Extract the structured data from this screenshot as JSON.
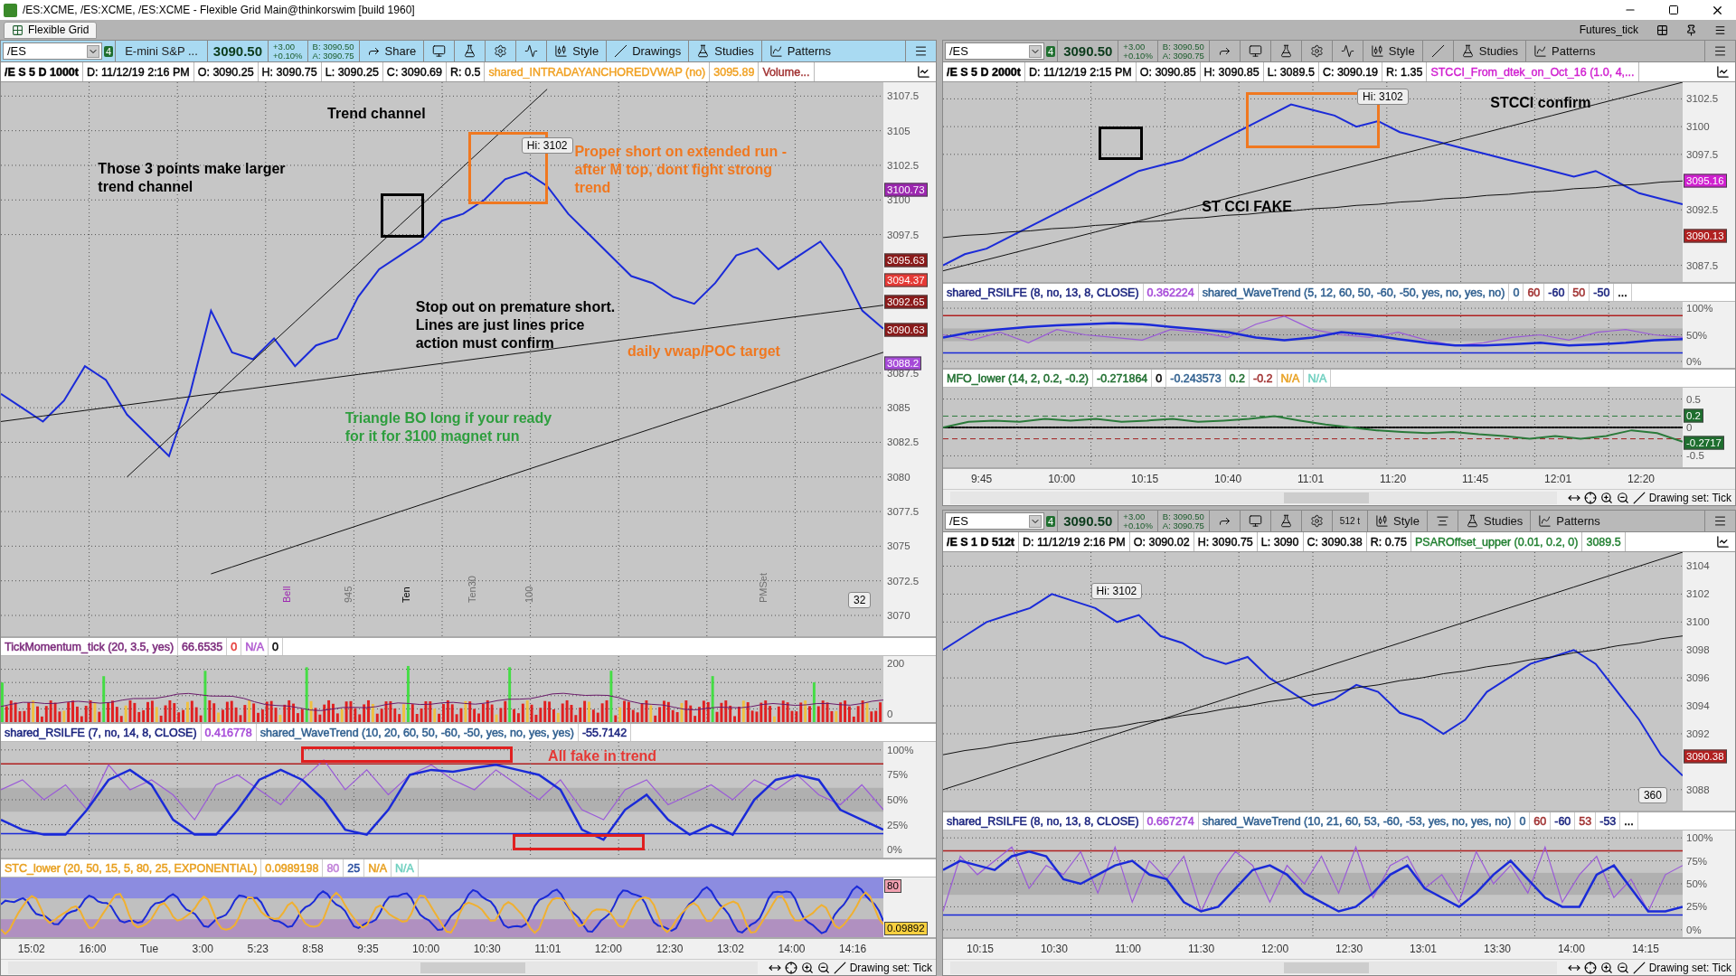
{
  "window": {
    "title": "/ES:XCME, /ES:XCME, /ES:XCME - Flexible Grid Main@thinkorswim [build 1960]"
  },
  "tab": {
    "label": "Flexible Grid",
    "selected": true
  },
  "grid_name": "Futures_tick",
  "charts": [
    {
      "focused": true,
      "toolbar": {
        "symbol": "/ES",
        "badge": "4",
        "name": "E-mini S&P ...",
        "price": "3090.50",
        "change": "+3.00",
        "change_pct": "+0.10%",
        "bid": "B: 3090.50",
        "ask": "A: 3090.75",
        "buttons": [
          {
            "kind": "share",
            "label": "Share"
          },
          {
            "kind": "monitor"
          },
          {
            "kind": "flask"
          },
          {
            "kind": "gear"
          },
          {
            "kind": "wave"
          },
          {
            "kind": "style",
            "label": "Style"
          },
          {
            "kind": "line",
            "label": "Drawings"
          },
          {
            "kind": "flask",
            "label": "Studies"
          },
          {
            "kind": "patterns",
            "label": "Patterns"
          },
          {
            "kind": "menu"
          }
        ]
      },
      "info": [
        {
          "text": "/E S 5 D 1000t",
          "color": "#000000"
        },
        {
          "text": "D: 11/12/19 2:16 PM",
          "color": "#000000"
        },
        {
          "text": "O: 3090.25",
          "color": "#000000"
        },
        {
          "text": "H: 3090.75",
          "color": "#000000"
        },
        {
          "text": "L: 3090.25",
          "color": "#000000"
        },
        {
          "text": "C: 3090.69",
          "color": "#000000"
        },
        {
          "text": "R: 0.5",
          "color": "#000000"
        },
        {
          "text": "shared_INTRADAYANCHOREDVWAP (no)",
          "color": "#f0a020"
        },
        {
          "text": "3095.89",
          "color": "#f0a020"
        },
        {
          "text": "Volume...",
          "color": "#a03030"
        }
      ],
      "panes": [
        {
          "kind": "price",
          "chart_data": {
            "type": "line",
            "ylim": [
              3068.5,
              3108.5
            ],
            "yticks": [
              3107.5,
              3105,
              3102.5,
              3100,
              3097.5,
              3087.5,
              3085,
              3082.5,
              3080,
              3077.5,
              3075,
              3072.5,
              3070
            ],
            "grid": true,
            "series": [
              {
                "color": "#1a2ad8",
                "values": [
                  3086,
                  3085,
                  3084,
                  3085.5,
                  3088,
                  3087,
                  3084.5,
                  3083,
                  3081.5,
                  3086,
                  3092,
                  3089,
                  3088.5,
                  3090,
                  3088,
                  3089.5,
                  3090,
                  3093,
                  3095,
                  3096,
                  3097,
                  3098.5,
                  3099,
                  3100,
                  3101.5,
                  3102,
                  3101,
                  3099,
                  3097.5,
                  3096,
                  3094.5,
                  3094,
                  3093,
                  3092.5,
                  3094,
                  3096,
                  3096.5,
                  3095,
                  3096,
                  3097,
                  3095,
                  3092,
                  3090.7
                ]
              },
              {
                "color": "#111111",
                "values": [
                  null,
                  null,
                  null,
                  null,
                  null,
                  null,
                  3080,
                  3081.4,
                  3082.8,
                  3084.2,
                  3085.6,
                  3087,
                  3088.4,
                  3089.8,
                  3091.2,
                  3092.6,
                  3094,
                  3095.4,
                  3096.8,
                  3098.2,
                  3099.6,
                  3101,
                  3102.4,
                  3103.8,
                  3105.2,
                  3106.6,
                  3108,
                  null,
                  null,
                  null,
                  null,
                  null,
                  null,
                  null,
                  null,
                  null,
                  null,
                  null,
                  null,
                  null,
                  null,
                  null,
                  null
                ]
              },
              {
                "color": "#111111",
                "values": [
                  3084,
                  3084.2,
                  3084.4,
                  3084.6,
                  3084.8,
                  3085,
                  3085.2,
                  3085.4,
                  3085.6,
                  3085.8,
                  3086,
                  3086.2,
                  3086.4,
                  3086.6,
                  3086.8,
                  3087,
                  3087.2,
                  3087.4,
                  3087.6,
                  3087.8,
                  3088,
                  3088.2,
                  3088.4,
                  3088.6,
                  3088.8,
                  3089,
                  3089.2,
                  3089.4,
                  3089.6,
                  3089.8,
                  3090,
                  3090.2,
                  3090.4,
                  3090.6,
                  3090.8,
                  3091,
                  3091.2,
                  3091.4,
                  3091.6,
                  3091.8,
                  3092,
                  3092.2,
                  3092.4
                ]
              },
              {
                "color": "#111111",
                "values": [
                  null,
                  null,
                  null,
                  null,
                  null,
                  null,
                  null,
                  null,
                  null,
                  null,
                  3073,
                  3073.5,
                  3074,
                  3074.5,
                  3075,
                  3075.5,
                  3076,
                  3076.5,
                  3077,
                  3077.5,
                  3078,
                  3078.5,
                  3079,
                  3079.5,
                  3080,
                  3080.5,
                  3081,
                  3081.5,
                  3082,
                  3082.5,
                  3083,
                  3083.5,
                  3084,
                  3084.5,
                  3085,
                  3085.5,
                  3086,
                  3086.5,
                  3087,
                  3087.5,
                  3088,
                  3088.5,
                  3089
                ]
              }
            ]
          },
          "axis": [
            {
              "kind": "tag",
              "text": "3100.73",
              "color": "#9c27b0"
            },
            {
              "kind": "tag",
              "text": "3095.63",
              "color": "#8b1a1a"
            },
            {
              "kind": "tag",
              "text": "3094.37",
              "color": "#e53935"
            },
            {
              "kind": "tag",
              "text": "3092.65",
              "color": "#8b1a1a"
            },
            {
              "kind": "tag",
              "text": "3090.63",
              "color": "#8b1a1a"
            },
            {
              "kind": "tag",
              "text": "3088.2",
              "color": "#a64ad8"
            }
          ],
          "annotations": [
            {
              "kind": "note",
              "text": "Trend channel",
              "color": "#000000"
            },
            {
              "kind": "note",
              "text": "Those 3 points make larger trend channel",
              "color": "#000000"
            },
            {
              "kind": "note",
              "text": "Proper short on extended run - after M top, dont fight strong trend",
              "color": "#f07820"
            },
            {
              "kind": "note",
              "text": "Stop out on premature short. Lines are just lines price action must confirm",
              "color": "#000000"
            },
            {
              "kind": "note",
              "text": "daily vwap/POC target",
              "color": "#f07820"
            },
            {
              "kind": "note",
              "text": "Triangle BO long if your ready for it for 3100 magnet run",
              "color": "#2e9e3e"
            },
            {
              "kind": "label",
              "text": "Hi: 3102",
              "color": "#000000"
            },
            {
              "kind": "label",
              "text": "32",
              "color": "#000000"
            },
            {
              "kind": "vertical",
              "text": "Bell",
              "color": "#9c27b0"
            },
            {
              "kind": "vertical",
              "text": "945",
              "color": "#707070"
            },
            {
              "kind": "vertical",
              "text": "Ten",
              "color": "#000000"
            },
            {
              "kind": "vertical",
              "text": "Ten30",
              "color": "#707070"
            },
            {
              "kind": "vertical",
              "text": "100",
              "color": "#707070"
            },
            {
              "kind": "vertical",
              "text": "PMSet",
              "color": "#707070"
            }
          ]
        },
        {
          "kind": "histogram",
          "studies": [
            {
              "text": "TickMomentum_tick (20, 3.5, yes)",
              "color": "#7b2a7b"
            },
            {
              "text": "66.6535",
              "color": "#7b2a7b"
            },
            {
              "text": "0",
              "color": "#e53935"
            },
            {
              "text": "N/A",
              "color": "#b05ad0"
            },
            {
              "text": "0",
              "color": "#000000"
            }
          ],
          "axis": [
            {
              "kind": "tick",
              "text": "200"
            },
            {
              "kind": "tick",
              "text": "0"
            }
          ]
        },
        {
          "kind": "oscillator",
          "studies": [
            {
              "text": "shared_RSILFE (7, no, 14, 8, CLOSE)",
              "color": "#1a237e"
            },
            {
              "text": "0.416778",
              "color": "#a64ad8"
            },
            {
              "text": "shared_WaveTrend (10, 20, 60, 50, -60, -50, yes, no, yes, yes)",
              "color": "#2f5f8f"
            },
            {
              "text": "-55.7142",
              "color": "#1a237e"
            }
          ],
          "chart_data": {
            "type": "line",
            "ylim": [
              -8,
              108
            ],
            "yticks": [
              {
                "value": 100,
                "label": "100%"
              },
              {
                "value": 75,
                "label": "75%"
              },
              {
                "value": 50,
                "label": "50%"
              },
              {
                "value": 25,
                "label": "25%"
              },
              {
                "value": 0,
                "label": "0%"
              }
            ],
            "grid": true,
            "series": [
              {
                "color": "#9a5ad8",
                "values": [
                  60,
                  70,
                  50,
                  65,
                  40,
                  85,
                  60,
                  70,
                  55,
                  30,
                  65,
                  75,
                  60,
                  45,
                  70,
                  90,
                  60,
                  80,
                  55,
                  75,
                  85,
                  70,
                  60,
                  80,
                  65,
                  50,
                  70,
                  40,
                  30,
                  60,
                  70,
                  45,
                  55,
                  65,
                  50,
                  70,
                  60,
                  75,
                  55,
                  45,
                  65,
                  40
                ]
              },
              {
                "color": "#1a2ad8",
                "values": [
                  30,
                  20,
                  15,
                  15,
                  40,
                  70,
                  80,
                  65,
                  30,
                  15,
                  15,
                  40,
                  70,
                  80,
                  70,
                  50,
                  20,
                  15,
                  40,
                  75,
                  80,
                  78,
                  82,
                  85,
                  80,
                  75,
                  60,
                  20,
                  10,
                  40,
                  55,
                  30,
                  15,
                  25,
                  15,
                  50,
                  70,
                  75,
                  70,
                  40,
                  30,
                  20
                ]
              }
            ]
          },
          "annotations": [
            {
              "kind": "note",
              "text": "All fake in trend",
              "color": "#e53935"
            }
          ]
        },
        {
          "kind": "stc",
          "studies": [
            {
              "text": "STC_lower (20, 50, 15, 5, 80, 25, EXPONENTIAL)",
              "color": "#e8a020"
            },
            {
              "text": "0.0989198",
              "color": "#e8a020"
            },
            {
              "text": "80",
              "color": "#c080d8"
            },
            {
              "text": "25",
              "color": "#2a4ea0"
            },
            {
              "text": "N/A",
              "color": "#e8a020"
            },
            {
              "text": "N/A",
              "color": "#70d0c0"
            }
          ],
          "axis": [
            {
              "kind": "tag",
              "text": "80",
              "color": "#f0a0b0"
            },
            {
              "kind": "tag",
              "text": "0.09892",
              "color": "#f8d040"
            }
          ]
        }
      ],
      "x_axis": [
        "15:02",
        "16:00",
        "Tue",
        "3:00",
        "5:23",
        "8:58",
        "9:35",
        "10:00",
        "10:30",
        "11:01",
        "12:00",
        "12:30",
        "13:02",
        "14:00",
        "14:16"
      ],
      "drawing_set": "Drawing set: Tick"
    },
    {
      "focused": false,
      "toolbar": {
        "symbol": "/ES",
        "badge": "4",
        "price": "3090.50",
        "change": "+3.00",
        "change_pct": "+0.10%",
        "bid": "B: 3090.50",
        "ask": "A: 3090.75",
        "buttons": [
          {
            "kind": "share"
          },
          {
            "kind": "monitor"
          },
          {
            "kind": "flask"
          },
          {
            "kind": "gear"
          },
          {
            "kind": "wave"
          },
          {
            "kind": "style",
            "label": "Style"
          },
          {
            "kind": "line"
          },
          {
            "kind": "flask",
            "label": "Studies"
          },
          {
            "kind": "patterns",
            "label": "Patterns"
          },
          {
            "kind": "menu"
          }
        ]
      },
      "info": [
        {
          "text": "/E S 5 D 2000t",
          "color": "#000000"
        },
        {
          "text": "D: 11/12/19 2:15 PM",
          "color": "#000000"
        },
        {
          "text": "O: 3090.85",
          "color": "#000000"
        },
        {
          "text": "H: 3090.85",
          "color": "#000000"
        },
        {
          "text": "L: 3089.5",
          "color": "#000000"
        },
        {
          "text": "C: 3090.19",
          "color": "#000000"
        },
        {
          "text": "R: 1.35",
          "color": "#000000"
        },
        {
          "text": "STCCI_From_dtek_on_Oct_16 (1.0, 4,...",
          "color": "#d020d0"
        }
      ],
      "panes": [
        {
          "kind": "price",
          "chart_data": {
            "type": "line",
            "ylim": [
              3086,
              3104
            ],
            "yticks": [
              3102.5,
              3100,
              3097.5,
              3092.5,
              3087.5
            ],
            "grid": true,
            "series": [
              {
                "color": "#1a2ad8",
                "values": [
                  3087.5,
                  3088.5,
                  3089,
                  3090,
                  3091,
                  3092,
                  3093,
                  3094,
                  3095,
                  3096,
                  3096.5,
                  3097,
                  3098,
                  3099,
                  3100,
                  3101,
                  3102,
                  3101.5,
                  3101,
                  3100,
                  3100.5,
                  3099.5,
                  3099,
                  3098.5,
                  3098,
                  3097.5,
                  3097,
                  3096.5,
                  3096,
                  3095.5,
                  3096,
                  3095,
                  3094,
                  3093.5,
                  3093
                ]
              },
              {
                "color": "#111111",
                "values": [
                  3087,
                  3087.5,
                  3088,
                  3088.5,
                  3089,
                  3089.5,
                  3090,
                  3090.5,
                  3091,
                  3091.5,
                  3092,
                  3092.5,
                  3093,
                  3093.5,
                  3094,
                  3094.5,
                  3095,
                  3095.5,
                  3096,
                  3096.5,
                  3097,
                  3097.5,
                  3098,
                  3098.5,
                  3099,
                  3099.5,
                  3100,
                  3100.5,
                  3101,
                  3101.5,
                  3102,
                  3102.5,
                  3103,
                  3103.5,
                  3104
                ]
              },
              {
                "color": "#111111",
                "values": [
                  3090,
                  3090.2,
                  3090.3,
                  3090.5,
                  3090.6,
                  3090.8,
                  3090.9,
                  3091.1,
                  3091.2,
                  3091.4,
                  3091.5,
                  3091.7,
                  3091.8,
                  3092,
                  3092.1,
                  3092.3,
                  3092.4,
                  3092.6,
                  3092.7,
                  3092.9,
                  3093,
                  3093.2,
                  3093.3,
                  3093.5,
                  3093.6,
                  3093.8,
                  3093.9,
                  3094.1,
                  3094.2,
                  3094.4,
                  3094.5,
                  3094.7,
                  3094.8,
                  3095,
                  3095.1
                ]
              }
            ]
          },
          "axis": [
            {
              "kind": "tag",
              "text": "3095.16",
              "color": "#d020d0"
            },
            {
              "kind": "tag",
              "text": "3090.13",
              "color": "#b02020"
            }
          ],
          "annotations": [
            {
              "kind": "note",
              "text": "STCCI confirm",
              "color": "#000000"
            },
            {
              "kind": "note",
              "text": "ST CCI  FAKE",
              "color": "#000000"
            },
            {
              "kind": "label",
              "text": "Hi: 3102",
              "color": "#000000"
            }
          ]
        },
        {
          "kind": "oscillator",
          "studies": [
            {
              "text": "shared_RSILFE (8, no, 13, 8, CLOSE)",
              "color": "#1a237e"
            },
            {
              "text": "0.362224",
              "color": "#a64ad8"
            },
            {
              "text": "shared_WaveTrend (5, 12, 60, 50, -60, -50, yes, no, yes, no)",
              "color": "#2f5f8f"
            },
            {
              "text": "0",
              "color": "#2f5f8f"
            },
            {
              "text": "60",
              "color": "#a03030"
            },
            {
              "text": "-60",
              "color": "#1a237e"
            },
            {
              "text": "50",
              "color": "#a03030"
            },
            {
              "text": "-50",
              "color": "#1a237e"
            },
            {
              "text": "..."
            }
          ],
          "chart_data": {
            "type": "line",
            "ylim": [
              -12,
              112
            ],
            "yticks": [
              {
                "value": 100,
                "label": "100%"
              },
              {
                "value": 50,
                "label": "50%"
              },
              {
                "value": 0,
                "label": "0%"
              }
            ],
            "grid": true,
            "series": [
              {
                "color": "#9a5ad8",
                "values": [
                  50,
                  40,
                  55,
                  35,
                  60,
                  50,
                  45,
                  40,
                  60,
                  55,
                  45,
                  70,
                  85,
                  60,
                  50,
                  45,
                  55,
                  40,
                  30,
                  35,
                  45,
                  50,
                  40,
                  55,
                  60,
                  50,
                  45
                ]
              },
              {
                "color": "#1a2ad8",
                "values": [
                  45,
                  55,
                  60,
                  65,
                  68,
                  70,
                  72,
                  70,
                  65,
                  60,
                  55,
                  45,
                  40,
                  45,
                  55,
                  50,
                  42,
                  35,
                  30,
                  30,
                  32,
                  35,
                  30,
                  32,
                  35,
                  40,
                  42
                ]
              }
            ]
          }
        },
        {
          "kind": "mfo",
          "studies": [
            {
              "text": "MFO_lower (14, 2, 0.2, -0.2)",
              "color": "#1e6e2e"
            },
            {
              "text": "-0.271864",
              "color": "#1e6e2e"
            },
            {
              "text": "0",
              "color": "#000000"
            },
            {
              "text": "-0.243573",
              "color": "#2f5f8f"
            },
            {
              "text": "0.2",
              "color": "#1e6e2e"
            },
            {
              "text": "-0.2",
              "color": "#a03030"
            },
            {
              "text": "N/A",
              "color": "#e8a020"
            },
            {
              "text": "N/A",
              "color": "#70d0c0"
            }
          ],
          "chart_data": {
            "type": "line",
            "ylim": [
              -0.7,
              0.7
            ],
            "yticks": [
              0.5,
              0,
              -0.5
            ],
            "grid": true,
            "series": [
              {
                "color": "#2a7a3a",
                "values": [
                  0,
                  0.1,
                  0.12,
                  0.1,
                  0.15,
                  0.12,
                  0.15,
                  0.1,
                  0.12,
                  0.15,
                  0.1,
                  0.12,
                  0.15,
                  0.2,
                  0.12,
                  0.05,
                  0,
                  -0.05,
                  -0.08,
                  -0.1,
                  -0.08,
                  -0.12,
                  -0.15,
                  -0.2,
                  -0.15,
                  -0.2,
                  -0.15,
                  -0.05,
                  -0.1,
                  -0.25
                ]
              }
            ]
          },
          "axis": [
            {
              "kind": "tag",
              "text": "0.2",
              "color": "#1e6e2e"
            },
            {
              "kind": "tag",
              "text": "-0.2717",
              "color": "#1e6e2e"
            }
          ]
        }
      ],
      "x_axis": [
        "9:45",
        "10:00",
        "10:15",
        "10:40",
        "11:01",
        "11:20",
        "11:45",
        "12:01",
        "12:20"
      ],
      "drawing_set": "Drawing set: Tick"
    },
    {
      "focused": false,
      "toolbar": {
        "symbol": "/ES",
        "badge": "4",
        "price": "3090.50",
        "change": "+3.00",
        "change_pct": "+0.10%",
        "bid": "B: 3090.50",
        "ask": "A: 3090.75",
        "buttons": [
          {
            "kind": "share"
          },
          {
            "kind": "monitor"
          },
          {
            "kind": "flask"
          },
          {
            "kind": "gear"
          },
          {
            "kind": "ticks",
            "label": "512 t"
          },
          {
            "kind": "style",
            "label": "Style"
          },
          {
            "kind": "level"
          },
          {
            "kind": "flask",
            "label": "Studies"
          },
          {
            "kind": "patterns",
            "label": "Patterns"
          },
          {
            "kind": "menu"
          }
        ]
      },
      "info": [
        {
          "text": "/E S 1 D 512t",
          "color": "#000000"
        },
        {
          "text": "D: 11/12/19 2:16 PM",
          "color": "#000000"
        },
        {
          "text": "O: 3090.02",
          "color": "#000000"
        },
        {
          "text": "H: 3090.75",
          "color": "#000000"
        },
        {
          "text": "L: 3090",
          "color": "#000000"
        },
        {
          "text": "C: 3090.38",
          "color": "#000000"
        },
        {
          "text": "R: 0.75",
          "color": "#000000"
        },
        {
          "text": "PSAROffset_upper (0.01, 0.2, 0)",
          "color": "#1e7e2e"
        },
        {
          "text": "3089.5",
          "color": "#1e7e2e"
        }
      ],
      "panes": [
        {
          "kind": "price",
          "chart_data": {
            "type": "line",
            "ylim": [
              3086.5,
              3105
            ],
            "yticks": [
              3104,
              3102,
              3100,
              3098,
              3096,
              3094,
              3092,
              3088
            ],
            "grid": true,
            "series": [
              {
                "color": "#1a2ad8",
                "values": [
                  3098,
                  3099,
                  3100,
                  3100.5,
                  3101,
                  3102,
                  3101.5,
                  3101,
                  3100,
                  3100.5,
                  3099,
                  3098.5,
                  3097.5,
                  3097,
                  3097.5,
                  3096,
                  3095,
                  3094,
                  3094.5,
                  3095.5,
                  3095,
                  3093.5,
                  3093,
                  3092,
                  3093,
                  3095,
                  3096,
                  3097,
                  3097.5,
                  3098,
                  3097,
                  3095,
                  3093,
                  3090.5,
                  3089
                ]
              },
              {
                "color": "#111111",
                "values": [
                  3088,
                  3088.5,
                  3089,
                  3089.5,
                  3090,
                  3090.5,
                  3091,
                  3091.5,
                  3092,
                  3092.5,
                  3093,
                  3093.5,
                  3094,
                  3094.5,
                  3095,
                  3095.5,
                  3096,
                  3096.5,
                  3097,
                  3097.5,
                  3098,
                  3098.5,
                  3099,
                  3099.5,
                  3100,
                  3100.5,
                  3101,
                  3101.5,
                  3102,
                  3102.5,
                  3103,
                  3103.5,
                  3104,
                  3104.5,
                  3105
                ]
              },
              {
                "color": "#111111",
                "values": [
                  3090.5,
                  3090.8,
                  3091,
                  3091.3,
                  3091.5,
                  3091.8,
                  3092,
                  3092.3,
                  3092.5,
                  3092.8,
                  3093,
                  3093.3,
                  3093.5,
                  3093.8,
                  3094,
                  3094.3,
                  3094.5,
                  3094.8,
                  3095,
                  3095.3,
                  3095.5,
                  3095.8,
                  3096,
                  3096.3,
                  3096.5,
                  3096.8,
                  3097,
                  3097.3,
                  3097.5,
                  3097.8,
                  3098,
                  3098.3,
                  3098.5,
                  3098.8,
                  3099
                ]
              }
            ]
          },
          "axis": [
            {
              "kind": "tag",
              "text": "3090.38",
              "color": "#b02020"
            }
          ],
          "annotations": [
            {
              "kind": "label",
              "text": "Hi: 3102",
              "color": "#000000"
            },
            {
              "kind": "label",
              "text": "360",
              "color": "#000000"
            }
          ]
        },
        {
          "kind": "oscillator",
          "studies": [
            {
              "text": "shared_RSILFE (8, no, 13, 8, CLOSE)",
              "color": "#1a237e"
            },
            {
              "text": "0.667274",
              "color": "#a64ad8"
            },
            {
              "text": "shared_WaveTrend (10, 21, 60, 53, -60, -53, yes, no, yes, no)",
              "color": "#2f5f8f"
            },
            {
              "text": "0",
              "color": "#2f5f8f"
            },
            {
              "text": "60",
              "color": "#a03030"
            },
            {
              "text": "-60",
              "color": "#1a237e"
            },
            {
              "text": "53",
              "color": "#a03030"
            },
            {
              "text": "-53",
              "color": "#1a237e"
            },
            {
              "text": "..."
            }
          ],
          "chart_data": {
            "type": "line",
            "ylim": [
              -8,
              108
            ],
            "yticks": [
              {
                "value": 100,
                "label": "100%"
              },
              {
                "value": 75,
                "label": "75%"
              },
              {
                "value": 50,
                "label": "50%"
              },
              {
                "value": 25,
                "label": "25%"
              },
              {
                "value": 0,
                "label": "0%"
              }
            ],
            "grid": true,
            "series": [
              {
                "color": "#9a5ad8",
                "values": [
                  20,
                  80,
                  60,
                  75,
                  90,
                  45,
                  70,
                  60,
                  85,
                  40,
                  90,
                  30,
                  75,
                  55,
                  80,
                  20,
                  60,
                  85,
                  70,
                  30,
                  70,
                  50,
                  80,
                  40,
                  90,
                  35,
                  70,
                  80,
                  45,
                  60,
                  30,
                  85,
                  50,
                  70,
                  40,
                  90,
                  30,
                  60,
                  80,
                  35,
                  55,
                  20,
                  60,
                  70
                ]
              },
              {
                "color": "#1a2ad8",
                "values": [
                  65,
                  75,
                  70,
                  65,
                  80,
                  85,
                  80,
                  55,
                  50,
                  60,
                  70,
                  75,
                  60,
                  55,
                  30,
                  20,
                  25,
                  45,
                  65,
                  70,
                  60,
                  40,
                  30,
                  20,
                  25,
                  40,
                  60,
                  70,
                  45,
                  35,
                  25,
                  40,
                  60,
                  75,
                  55,
                  35,
                  25,
                  25,
                  60,
                  70,
                  45,
                  20,
                  20,
                  25
                ]
              }
            ]
          }
        }
      ],
      "x_axis": [
        "10:15",
        "10:30",
        "11:00",
        "11:30",
        "12:00",
        "12:30",
        "13:01",
        "13:30",
        "14:00",
        "14:15"
      ],
      "drawing_set": "Drawing set: Tick"
    }
  ]
}
